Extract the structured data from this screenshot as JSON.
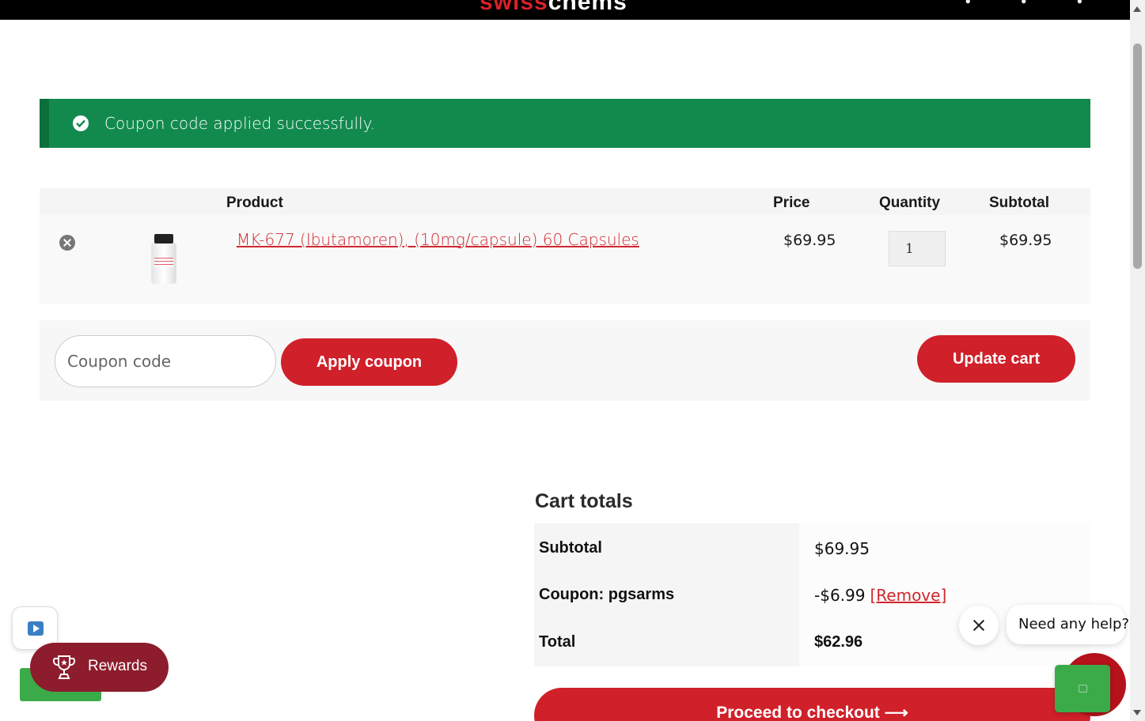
{
  "header": {
    "logo_part1": "swiss",
    "logo_part2": "chems"
  },
  "notice": {
    "message": "Coupon code applied successfully.",
    "color": "#128a4e"
  },
  "cart": {
    "columns": {
      "product": "Product",
      "price": "Price",
      "quantity": "Quantity",
      "subtotal": "Subtotal"
    },
    "items": [
      {
        "name": "MK-677 (Ibutamoren), (10mg/capsule) 60 Capsules",
        "price": "$69.95",
        "quantity": "1",
        "subtotal": "$69.95"
      }
    ]
  },
  "actions": {
    "coupon_placeholder": "Coupon code",
    "apply_label": "Apply coupon",
    "update_label": "Update cart"
  },
  "totals": {
    "title": "Cart totals",
    "subtotal_label": "Subtotal",
    "subtotal_value": "$69.95",
    "coupon_label": "Coupon: pgsarms",
    "coupon_value": "-$6.99",
    "coupon_remove": "[Remove]",
    "total_label": "Total",
    "total_value": "$62.96",
    "checkout_label": "Proceed to checkout ⟶"
  },
  "widgets": {
    "rewards_label": "Rewards",
    "chat_prompt": "Need any help?"
  },
  "colors": {
    "brand_red": "#d0202a",
    "rewards_bg": "#8d1c2c",
    "widget_green": "#3bab4a"
  }
}
